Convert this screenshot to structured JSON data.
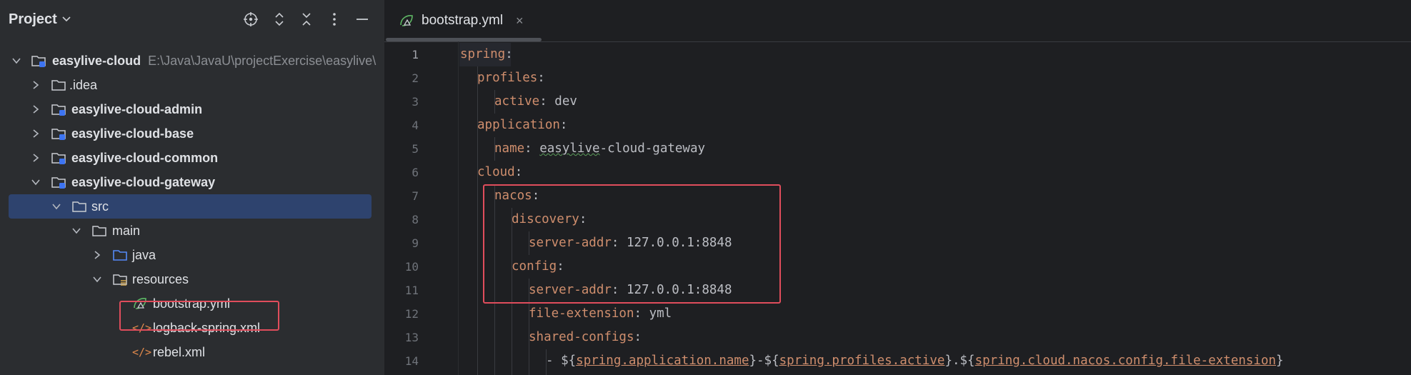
{
  "project_panel": {
    "title": "Project",
    "header_icons": [
      "target-icon",
      "expand-all-icon",
      "collapse-all-icon",
      "more-icon",
      "minimize-icon"
    ]
  },
  "tree": [
    {
      "label": "easylive-cloud",
      "path": "E:\\Java\\JavaU\\projectExercise\\easylive\\",
      "icon": "module-folder-icon",
      "expanded": true,
      "bold": true
    },
    {
      "label": ".idea",
      "icon": "folder-icon",
      "expanded": false
    },
    {
      "label": "easylive-cloud-admin",
      "icon": "module-folder-icon",
      "expanded": false,
      "bold": true
    },
    {
      "label": "easylive-cloud-base",
      "icon": "module-folder-icon",
      "expanded": false,
      "bold": true
    },
    {
      "label": "easylive-cloud-common",
      "icon": "module-folder-icon",
      "expanded": false,
      "bold": true
    },
    {
      "label": "easylive-cloud-gateway",
      "icon": "module-folder-icon",
      "expanded": true,
      "bold": true
    },
    {
      "label": "src",
      "icon": "folder-icon",
      "expanded": true,
      "selected": true
    },
    {
      "label": "main",
      "icon": "folder-icon",
      "expanded": true
    },
    {
      "label": "java",
      "icon": "source-folder-icon",
      "expanded": false
    },
    {
      "label": "resources",
      "icon": "resources-folder-icon",
      "expanded": true
    },
    {
      "label": "bootstrap.yml",
      "icon": "spring-yaml-icon"
    },
    {
      "label": "logback-spring.xml",
      "icon": "xml-icon"
    },
    {
      "label": "rebel.xml",
      "icon": "xml-icon"
    }
  ],
  "editor": {
    "tab": {
      "label": "bootstrap.yml",
      "close": "×"
    },
    "line_numbers": [
      "1",
      "2",
      "3",
      "4",
      "5",
      "6",
      "7",
      "8",
      "9",
      "10",
      "11",
      "12",
      "13",
      "14"
    ],
    "lines": [
      {
        "k": "spring",
        "p": ":",
        "v": ""
      },
      {
        "k": "profiles",
        "p": ":",
        "v": ""
      },
      {
        "k": "active",
        "p": ": ",
        "v": "dev"
      },
      {
        "k": "application",
        "p": ":",
        "v": ""
      },
      {
        "k": "name",
        "p": ": ",
        "v1": "easylive",
        "v2": "-cloud-gateway"
      },
      {
        "k": "cloud",
        "p": ":",
        "v": ""
      },
      {
        "k": "nacos",
        "p": ":",
        "v": ""
      },
      {
        "k": "discovery",
        "p": ":",
        "v": ""
      },
      {
        "k": "server-addr",
        "p": ": ",
        "v": "127.0.0.1:8848"
      },
      {
        "k": "config",
        "p": ":",
        "v": ""
      },
      {
        "k": "server-addr",
        "p": ": ",
        "v": "127.0.0.1:8848"
      },
      {
        "k": "file-extension",
        "p": ": ",
        "v": "yml"
      },
      {
        "k": "shared-configs",
        "p": ":",
        "v": ""
      },
      {
        "dash": "- ",
        "s1": "${",
        "r1": "spring.application.name",
        "s2": "}-${",
        "r2": "spring.profiles.active",
        "s3": "}.${",
        "r3": "spring.cloud.nacos.config.file-extension",
        "s4": "}"
      }
    ]
  },
  "colors": {
    "accent_box": "#e04d5c",
    "selection": "#2e436e",
    "key": "#cf8e6d"
  }
}
